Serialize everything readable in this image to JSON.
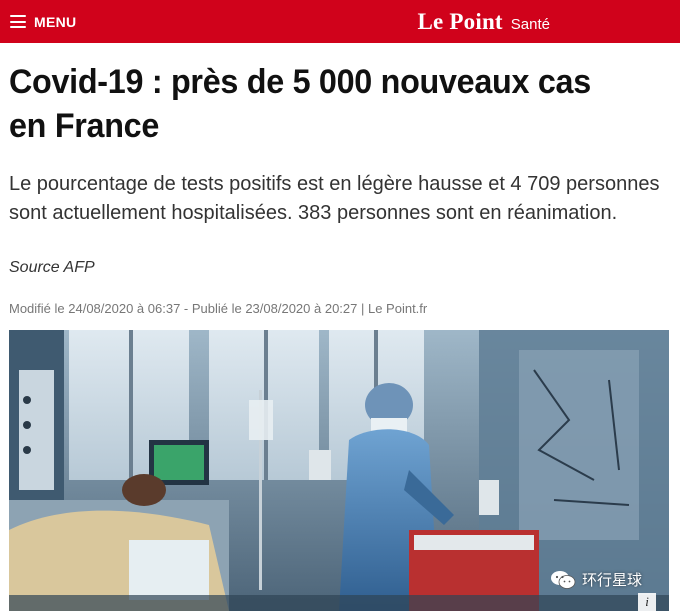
{
  "header": {
    "menu_label": "MENU",
    "brand": "Le Point",
    "section": "Santé",
    "bg_color": "#d0021b"
  },
  "article": {
    "title": "Covid-19 : près de 5 000 nouveaux cas en France",
    "lede": "Le pourcentage de tests positifs est en légère hausse et 4 709 personnes sont actuellement hospitalisées. 383 personnes sont en réanimation.",
    "source": "Source AFP",
    "meta": "Modifié le 24/08/2020 à 06:37 - Publié le 23/08/2020 à 20:27 | Le Point.fr"
  },
  "watermark": {
    "text": "环行星球",
    "icon": "wechat-icon",
    "info": "i"
  }
}
